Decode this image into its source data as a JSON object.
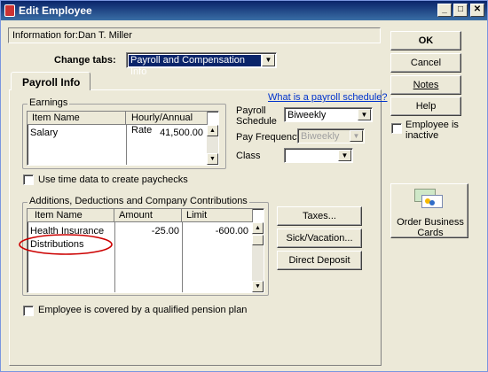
{
  "window": {
    "title": "Edit Employee",
    "minimize": "_",
    "maximize": "□",
    "close": "✕"
  },
  "info": {
    "text": "Information for:Dan T. Miller"
  },
  "change_tabs": {
    "label": "Change tabs:",
    "value": "Payroll and Compensation Info"
  },
  "side_buttons": {
    "ok": "OK",
    "cancel": "Cancel",
    "notes": "Notes",
    "help": "Help"
  },
  "employee_inactive": {
    "label": "Employee is inactive",
    "checked": false
  },
  "order_cards": {
    "label": "Order Business Cards"
  },
  "tab": {
    "label": "Payroll Info"
  },
  "payroll_schedule_link": "What is a payroll schedule?",
  "earnings": {
    "group_label": "Earnings",
    "columns": [
      "Item Name",
      "Hourly/Annual Rate"
    ],
    "rows": [
      {
        "item": "Salary",
        "rate": "41,500.00"
      }
    ]
  },
  "schedule": {
    "label_line1": "Payroll",
    "label_line2": "Schedule",
    "value": "Biweekly"
  },
  "pay_frequency": {
    "label": "Pay Frequency",
    "value": "Biweekly"
  },
  "class": {
    "label": "Class",
    "value": ""
  },
  "use_time_data": {
    "label": "Use time data to create paychecks",
    "checked": false
  },
  "additions": {
    "group_label": "Additions, Deductions and Company Contributions",
    "columns": [
      "Item Name",
      "Amount",
      "Limit"
    ],
    "rows": [
      {
        "item": "Health Insurance",
        "amount": "-25.00",
        "limit": "-600.00"
      },
      {
        "item": "Distributions",
        "amount": "",
        "limit": ""
      }
    ]
  },
  "right_buttons": {
    "taxes": "Taxes...",
    "sick_vacation": "Sick/Vacation...",
    "direct_deposit": "Direct Deposit"
  },
  "pension": {
    "label": "Employee is covered by a qualified pension plan",
    "checked": false
  },
  "colors": {
    "title_bar": "#0a246a",
    "link": "#0033cc",
    "highlight_ellipse": "#cc0000",
    "combo_selected": "#0a246a"
  }
}
